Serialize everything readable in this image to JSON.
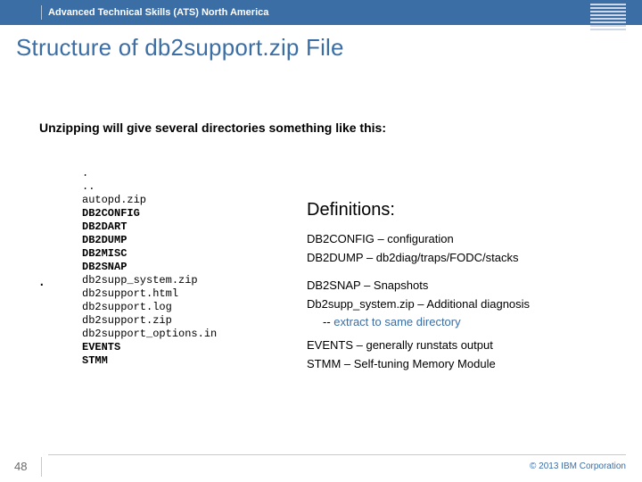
{
  "header": {
    "org": "Advanced Technical Skills (ATS) North America",
    "logo_name": "IBM"
  },
  "title": "Structure of db2support.zip File",
  "intro": "Unzipping will give several directories something like this:",
  "listing": {
    "l0": ".",
    "l1": "..",
    "l2": "autopd.zip",
    "l3": "DB2CONFIG",
    "l4": "DB2DART",
    "l5": "DB2DUMP",
    "l6": "DB2MISC",
    "l7": "DB2SNAP",
    "l8": "db2supp_system.zip",
    "l9": "db2support.html",
    "l10": "db2support.log",
    "l11": "db2support.zip",
    "l12": "db2support_options.in",
    "l13": "EVENTS",
    "l14": "STMM"
  },
  "definitions": {
    "heading": "Definitions:",
    "d1": "DB2CONFIG – configuration",
    "d2": "DB2DUMP – db2diag/traps/FODC/stacks",
    "d3": "DB2SNAP – Snapshots",
    "d4": "Db2supp_system.zip – Additional diagnosis",
    "d4sub_prefix": "-- ",
    "d4sub_blue": "extract to same directory",
    "d5": "EVENTS – generally runstats output",
    "d6": "STMM – Self-tuning Memory Module"
  },
  "footer": {
    "page": "48",
    "copyright": "© 2013 IBM Corporation"
  }
}
